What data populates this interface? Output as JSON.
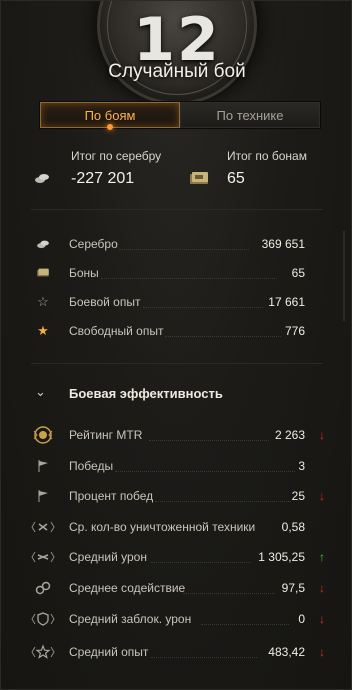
{
  "header": {
    "battle_count": "12",
    "battle_type": "Случайный бой"
  },
  "tabs": [
    {
      "label": "По боям",
      "active": true
    },
    {
      "label": "По технике",
      "active": false
    }
  ],
  "totals": {
    "silver": {
      "label": "Итог по серебру",
      "value": "-227 201",
      "icon": "silver-coins-icon"
    },
    "bonds": {
      "label": "Итог по бонам",
      "value": "65",
      "icon": "bonds-icon"
    }
  },
  "economy": [
    {
      "label": "Серебро",
      "value": "369 651",
      "icon": "silver-coins-icon"
    },
    {
      "label": "Боны",
      "value": "65",
      "icon": "bonds-icon"
    },
    {
      "label": "Боевой опыт",
      "value": "17 661",
      "icon": "star-outline-icon"
    },
    {
      "label": "Свободный опыт",
      "value": "776",
      "icon": "star-gold-icon"
    }
  ],
  "efficiency": {
    "title": "Боевая эффективность",
    "rows": [
      {
        "label": "Рейтинг MTR",
        "value": "2 263",
        "trend": "down",
        "icon": "mtr-rating-icon"
      },
      {
        "label": "Победы",
        "value": "3",
        "trend": "",
        "icon": "flag-icon"
      },
      {
        "label": "Процент побед",
        "value": "25",
        "trend": "down",
        "icon": "flag-icon"
      },
      {
        "label": "Ср. кол-во уничтоженной техники",
        "value": "0,58",
        "trend": "",
        "icon": "destroyed-icon"
      },
      {
        "label": "Средний урон",
        "value": "1 305,25",
        "trend": "up",
        "icon": "damage-icon"
      },
      {
        "label": "Среднее содействие",
        "value": "97,5",
        "trend": "down",
        "icon": "assist-icon"
      },
      {
        "label": "Средний заблок. урон",
        "value": "0",
        "trend": "down",
        "icon": "blocked-icon"
      },
      {
        "label": "Средний опыт",
        "value": "483,42",
        "trend": "down",
        "icon": "avg-exp-icon"
      }
    ]
  },
  "colors": {
    "accent_orange": "#ffb050",
    "trend_down": "#e0282a",
    "trend_up": "#33d13d"
  }
}
